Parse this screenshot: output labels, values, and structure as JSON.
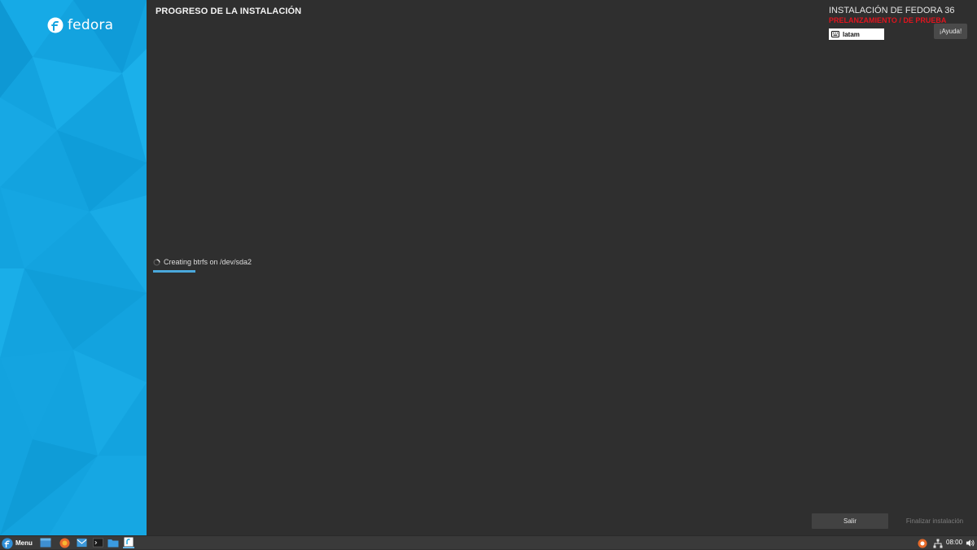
{
  "brand": {
    "name": "fedora"
  },
  "header": {
    "page_title": "PROGRESO DE LA INSTALACIÓN",
    "install_title": "INSTALACIÓN DE FEDORA 36",
    "prerelease_label": "PRELANZAMIENTO / DE PRUEBA",
    "keyboard_layout": "latam",
    "help_label": "¡Ayuda!"
  },
  "progress": {
    "status_text": "Creating btrfs on /dev/sda2",
    "fraction": 0.43
  },
  "footer": {
    "quit_label": "Salir",
    "finish_label": "Finalizar instalación"
  },
  "taskbar": {
    "menu_label": "Menu",
    "launchers": [
      "file-manager-icon",
      "firefox-icon",
      "mail-icon",
      "terminal-icon",
      "files-icon",
      "anaconda-installer-icon"
    ],
    "clock": "08:00"
  },
  "colors": {
    "sidebar_blue": "#13a3df",
    "background": "#2f2f2f",
    "prerelease_red": "#e0141e",
    "progress_blue": "#4aa8dc"
  }
}
